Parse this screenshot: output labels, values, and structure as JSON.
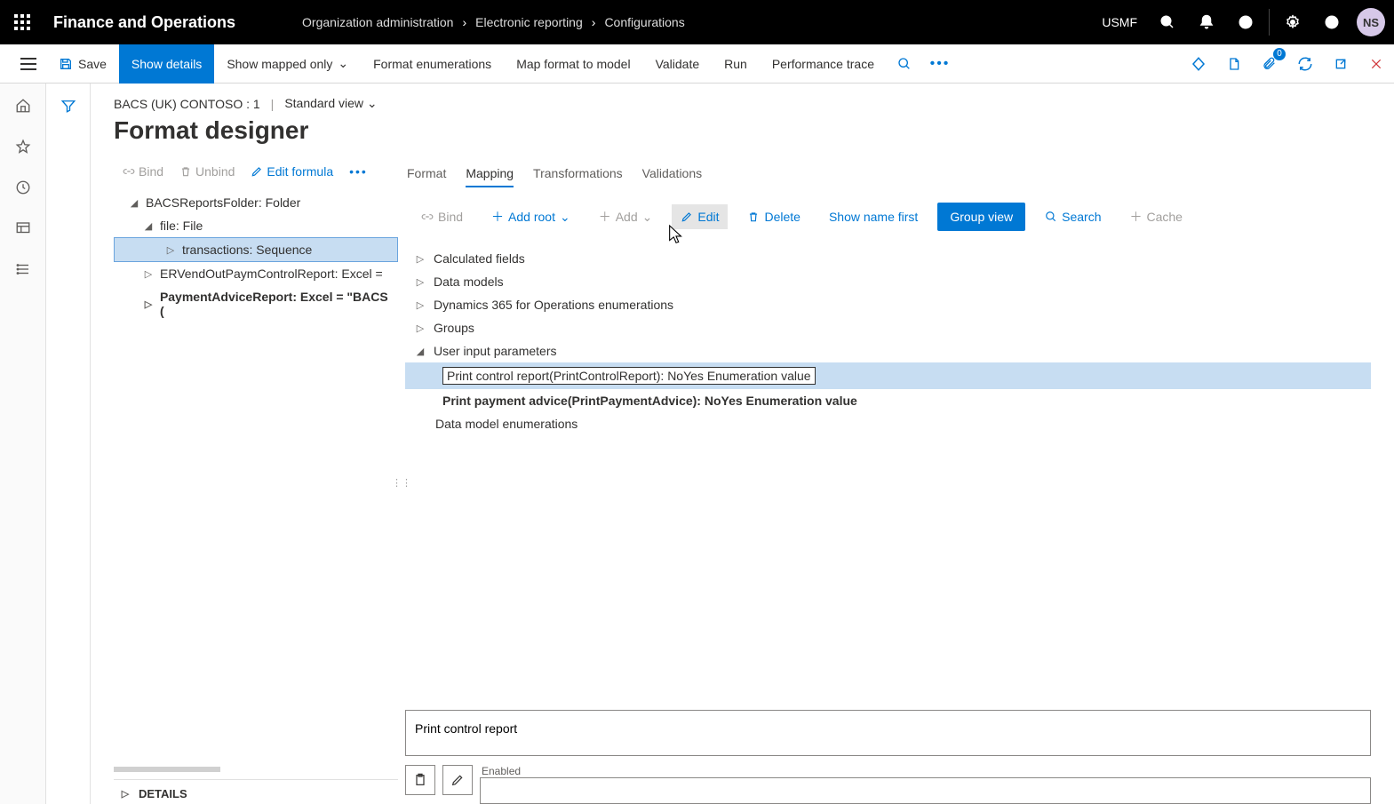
{
  "header": {
    "app_title": "Finance and Operations",
    "breadcrumb": [
      "Organization administration",
      "Electronic reporting",
      "Configurations"
    ],
    "company": "USMF",
    "avatar": "NS",
    "badge_count": "0"
  },
  "command_bar": {
    "save": "Save",
    "show_details": "Show details",
    "show_mapped_only": "Show mapped only",
    "format_enumerations": "Format enumerations",
    "map_format_to_model": "Map format to model",
    "validate": "Validate",
    "run": "Run",
    "performance_trace": "Performance trace"
  },
  "page": {
    "context_title": "BACS (UK) CONTOSO : 1",
    "view_name": "Standard view",
    "page_title": "Format designer"
  },
  "left_toolbar": {
    "bind": "Bind",
    "unbind": "Unbind",
    "edit_formula": "Edit formula"
  },
  "format_tree": {
    "root": "BACSReportsFolder: Folder",
    "file": "file: File",
    "transactions": "transactions: Sequence",
    "excel1": "ERVendOutPaymControlReport: Excel =",
    "excel2": "PaymentAdviceReport: Excel = \"BACS ("
  },
  "tabs": {
    "format": "Format",
    "mapping": "Mapping",
    "transformations": "Transformations",
    "validations": "Validations"
  },
  "mapping_toolbar": {
    "bind": "Bind",
    "add_root": "Add root",
    "add": "Add",
    "edit": "Edit",
    "delete": "Delete",
    "show_name_first": "Show name first",
    "group_view": "Group view",
    "search": "Search",
    "cache": "Cache"
  },
  "mapping_tree": {
    "calc_fields": "Calculated fields",
    "data_models": "Data models",
    "d365_enum": "Dynamics 365 for Operations enumerations",
    "groups": "Groups",
    "user_input": "User input parameters",
    "print_control": "Print control report(PrintControlReport): NoYes Enumeration value",
    "print_advice": "Print payment advice(PrintPaymentAdvice): NoYes Enumeration value",
    "data_model_enum": "Data model enumerations"
  },
  "details": {
    "input_value": "Print control report",
    "enabled_label": "Enabled",
    "footer": "DETAILS"
  }
}
